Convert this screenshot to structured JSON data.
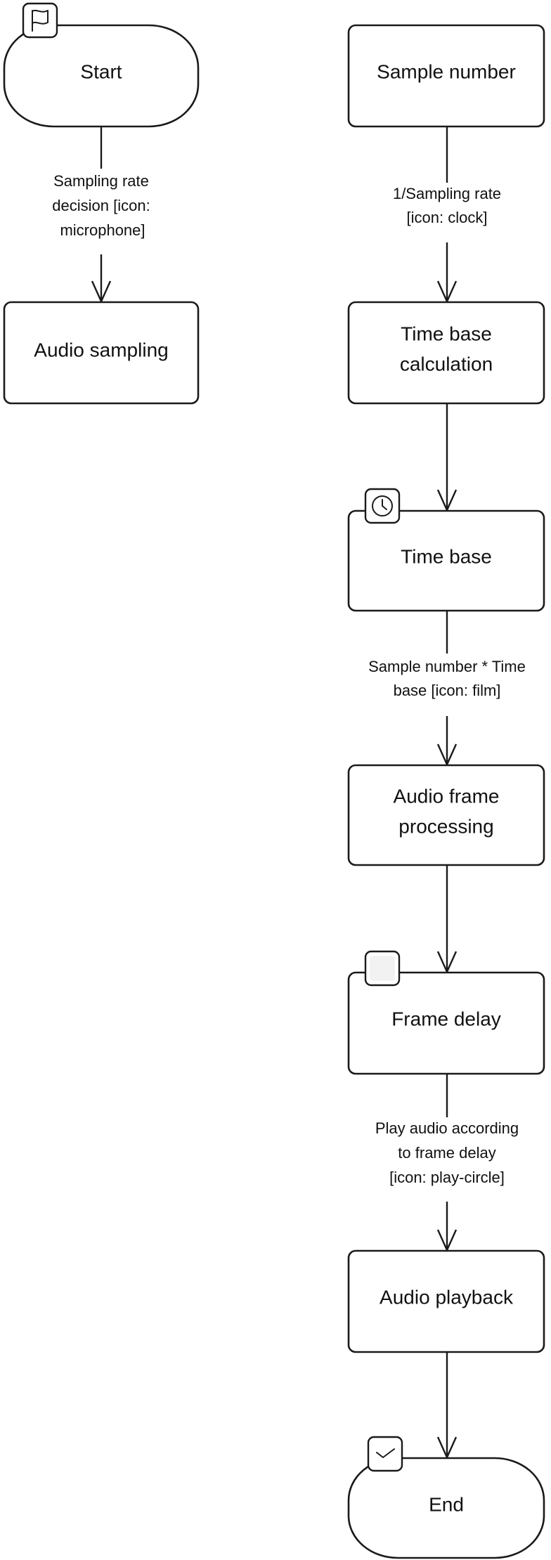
{
  "nodes": {
    "start": {
      "label": "Start",
      "icon": "flag-icon"
    },
    "audio_sampling": {
      "label": "Audio sampling"
    },
    "sample_number": {
      "label": "Sample number"
    },
    "time_base_calculation": {
      "lines": [
        "Time base",
        "calculation"
      ]
    },
    "time_base": {
      "label": "Time base",
      "icon": "clock-icon"
    },
    "audio_frame_processing": {
      "lines": [
        "Audio frame",
        "processing"
      ]
    },
    "frame_delay": {
      "label": "Frame delay",
      "icon": "blank-icon"
    },
    "audio_playback": {
      "label": "Audio playback"
    },
    "end": {
      "label": "End",
      "icon": "check-icon"
    }
  },
  "edges": {
    "start_to_audio_sampling": {
      "lines": [
        "Sampling rate",
        "decision [icon:",
        "microphone]"
      ]
    },
    "sample_number_to_time_base_calculation": {
      "lines": [
        "1/Sampling rate",
        "[icon: clock]"
      ]
    },
    "time_base_to_audio_frame_processing": {
      "lines": [
        "Sample number * Time",
        "base [icon: film]"
      ]
    },
    "frame_delay_to_audio_playback": {
      "lines": [
        "Play audio according",
        "to frame delay",
        "[icon: play-circle]"
      ]
    }
  }
}
